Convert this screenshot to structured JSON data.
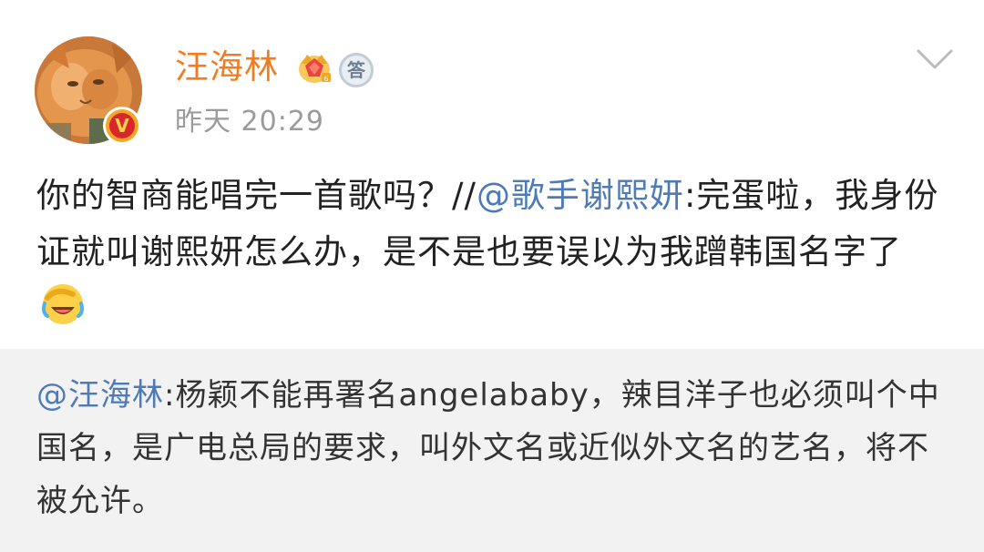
{
  "post": {
    "author": {
      "name": "汪海林",
      "avatar": "orange-cat-avatar",
      "verified_badge": "V",
      "badges": [
        "crown-vip-icon",
        "answer-badge-icon"
      ],
      "answer_badge_label": "答"
    },
    "timestamp": "昨天 20:29",
    "menu_icon": "chevron-down-icon",
    "body": {
      "text_part1": "你的智商能唱完一首歌吗？//",
      "mention": "@歌手谢熙妍",
      "text_part2": ":完蛋啦，我身份证就叫谢熙妍怎么办，是不是也要误以为我蹭韩国名字了",
      "emoji": "laughing-crying-emoji"
    },
    "quote": {
      "mention": "@汪海林",
      "text": ":杨颖不能再署名angelababy，辣目洋子也必须叫个中国名，是广电总局的要求，叫外文名或近似外文名的艺名，将不被允许。"
    }
  },
  "colors": {
    "username": "#f47b20",
    "mention": "#4e7bb8",
    "timestamp": "#9b9b9b",
    "quote_background": "#f2f2f2"
  }
}
